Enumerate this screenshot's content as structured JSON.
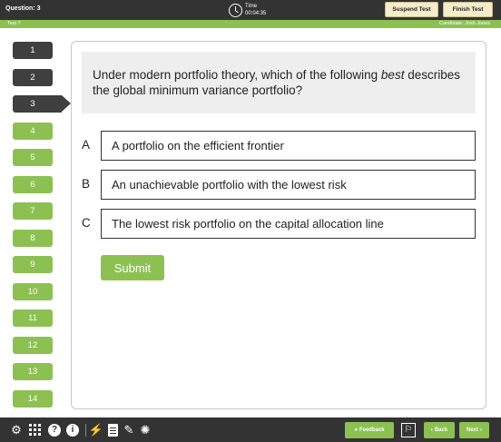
{
  "header": {
    "question_label": "Question: 3",
    "time_label": "Time",
    "time_value": "00:04:35",
    "suspend_label": "Suspend Test",
    "finish_label": "Finish Test"
  },
  "subheader": {
    "test_name": "Test 7",
    "candidate": "Candidate: Josh Jones"
  },
  "nav": {
    "questions": [
      "1",
      "2",
      "3",
      "4",
      "5",
      "6",
      "7",
      "8",
      "9",
      "10",
      "11",
      "12",
      "13",
      "14"
    ],
    "current": "3"
  },
  "question": {
    "text_before": "Under modern portfolio theory, which of the following ",
    "emphasis": "best",
    "text_after": " describes the global minimum variance portfolio?"
  },
  "options": [
    {
      "letter": "A",
      "text": "A portfolio on the efficient frontier"
    },
    {
      "letter": "B",
      "text": "An unachievable portfolio with the lowest risk"
    },
    {
      "letter": "C",
      "text": "The lowest risk portfolio on the capital allocation line"
    }
  ],
  "submit_label": "Submit",
  "footer": {
    "feedback_label": "Feedback",
    "back_label": "Back",
    "next_label": "Next",
    "icons": [
      "gear-icon",
      "grid-icon",
      "help-icon",
      "info-icon",
      "flash-icon",
      "document-icon",
      "edit-icon",
      "lightbulb-icon",
      "flag-icon"
    ]
  },
  "colors": {
    "accent_green": "#8cc152",
    "dark_bar": "#333333",
    "cream_button": "#f5ecc9"
  }
}
